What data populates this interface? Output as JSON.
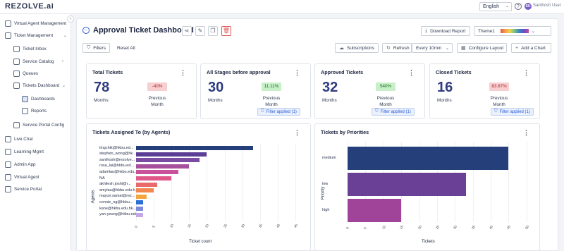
{
  "topbar": {
    "logo": "REZOLVE.ai",
    "language": "English",
    "help_icon": "help-circle-icon",
    "avatar_initials": "SU",
    "user_name": "Santhosh User"
  },
  "sidebar": {
    "items": [
      {
        "label": "Virtual Agent Management",
        "icon": "chat-bot-icon"
      },
      {
        "label": "Ticket Management",
        "icon": "ticket-icon"
      },
      {
        "label": "Ticket Inbox",
        "icon": "inbox-icon"
      },
      {
        "label": "Service Catalog",
        "icon": "catalog-icon"
      },
      {
        "label": "Queues",
        "icon": "queue-icon"
      },
      {
        "label": "Tickets Dashboard",
        "icon": "dashboard-icon"
      },
      {
        "label": "Dashboards",
        "icon": "grid-icon"
      },
      {
        "label": "Reports",
        "icon": "report-icon"
      },
      {
        "label": "Service Portal Config",
        "icon": "config-icon"
      },
      {
        "label": "Live Chat",
        "icon": "live-chat-icon"
      },
      {
        "label": "Learning Mgmt",
        "icon": "learning-icon"
      },
      {
        "label": "Admin App",
        "icon": "admin-icon"
      },
      {
        "label": "Virtual Agent",
        "icon": "agent-icon"
      },
      {
        "label": "Service Portal",
        "icon": "portal-icon"
      }
    ]
  },
  "header": {
    "title": "Approval Ticket Dashboard",
    "download_report": "Download Report",
    "theme": "Theme1",
    "filters": "Filters",
    "reset_all": "Reset All",
    "subscriptions": "Subscriptions",
    "refresh": "Refresh",
    "refresh_interval": "Every 10min",
    "configure_layout": "Configure Layout",
    "add_chart": "Add a Chart"
  },
  "kpis": [
    {
      "title": "Total Tickets",
      "value": "78",
      "sub": "Months",
      "change": "-40%",
      "trend": "neg",
      "prev_line1": "Previous",
      "prev_line2": "Month",
      "filter": ""
    },
    {
      "title": "All Stages before approval",
      "value": "30",
      "sub": "Months",
      "change": "11.11%",
      "trend": "pos",
      "prev_line1": "Previous",
      "prev_line2": "Month",
      "filter": "Filter applied (1)"
    },
    {
      "title": "Approved Tickets",
      "value": "32",
      "sub": "Months",
      "change": "540%",
      "trend": "pos",
      "prev_line1": "Previous",
      "prev_line2": "Month",
      "filter": "Filter applied (1)"
    },
    {
      "title": "Closed Tickets",
      "value": "16",
      "sub": "Months",
      "change": "83.67%",
      "trend": "neg",
      "prev_line1": "Previous",
      "prev_line2": "Month",
      "filter": "Filter applied (1)"
    }
  ],
  "chart_data": [
    {
      "type": "bar",
      "orientation": "horizontal",
      "title": "Tickets Assigned To (by Agents)",
      "xlabel": "Ticket count",
      "ylabel": "Agents",
      "categories": [
        "tingchik@hkbu.ed...",
        "stephen_wong@hk...",
        "santhosh@rezolve...",
        "rosa_lai@hkbu.ed...",
        "adamlau@hkbu.edu...",
        "NA",
        "akhilesh.joshi@r...",
        "amylau@hkbu.edu.h...",
        "mayuri.samal@rez...",
        "connie_ng@hkbu...",
        "kane@hkbu.edu.hk...",
        "yan-yeung@hkbu.edu..."
      ],
      "values": [
        33,
        20,
        18,
        15,
        12,
        10,
        6,
        5,
        3,
        2,
        2,
        2
      ],
      "colors": [
        "#243f7a",
        "#5b3e96",
        "#7b4aa3",
        "#a64f9c",
        "#c8519a",
        "#e0588a",
        "#e86a6a",
        "#f2874f",
        "#f4a63e",
        "#2b6fd6",
        "#7c8bdc",
        "#c4a8e6"
      ],
      "x_ticks": [
        "0",
        "5",
        "10",
        "15",
        "20",
        "25",
        "30",
        "35",
        "40",
        "45"
      ]
    },
    {
      "type": "bar",
      "orientation": "horizontal",
      "title": "Tickets by Priorities",
      "xlabel": "Tickets",
      "ylabel": "Priority",
      "categories": [
        "medium",
        "low",
        "high"
      ],
      "values": [
        45,
        33,
        15
      ],
      "colors": [
        "#243f7a",
        "#6a3f96",
        "#a0449a"
      ],
      "x_ticks": [
        "0",
        "5",
        "10",
        "15",
        "20",
        "25",
        "30",
        "35",
        "40",
        "45",
        "50"
      ]
    }
  ]
}
